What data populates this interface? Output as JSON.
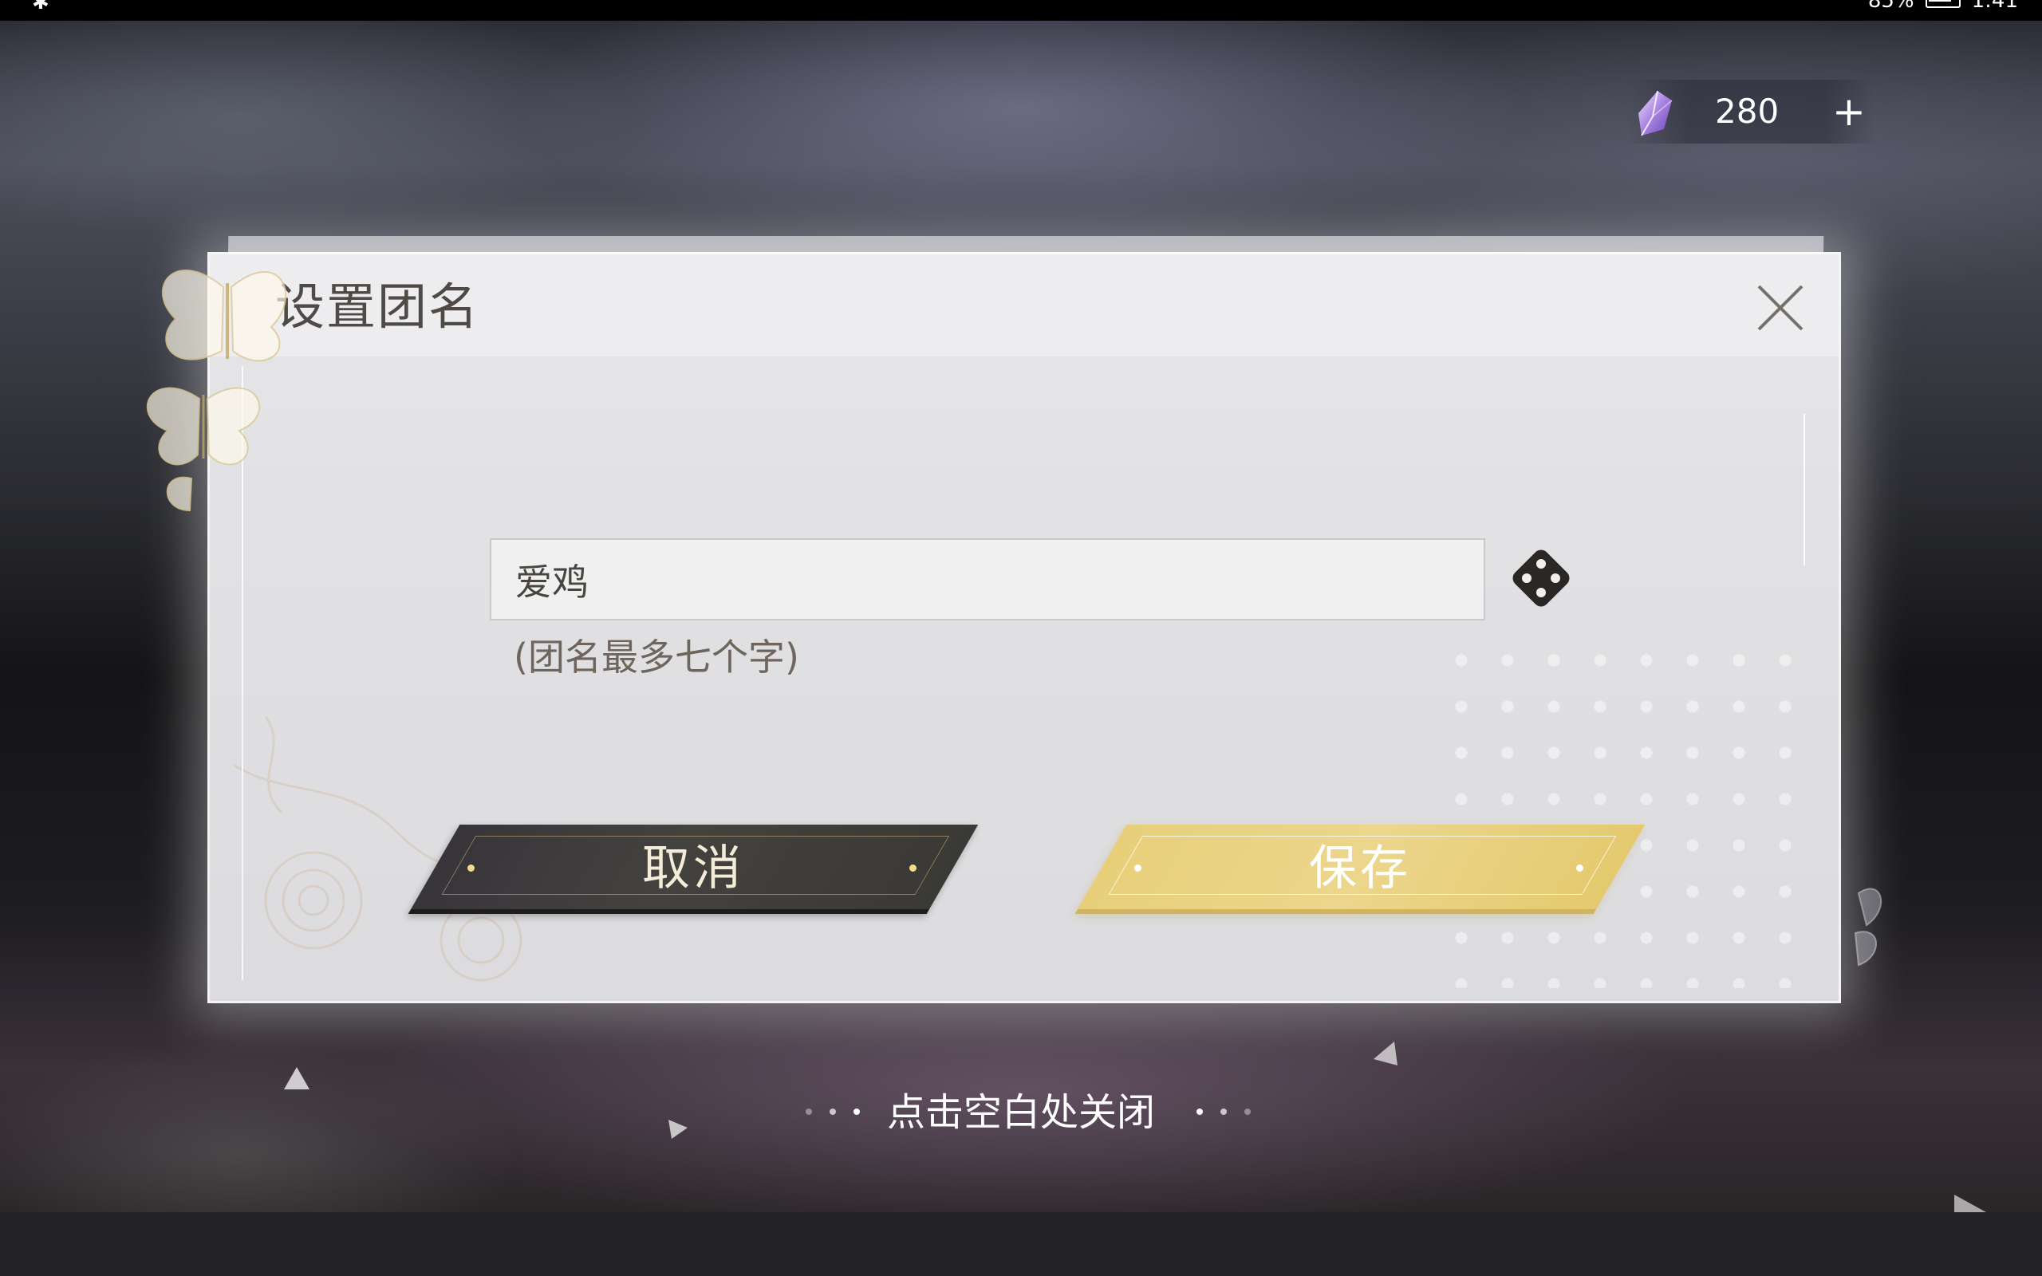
{
  "status_bar": {
    "left_icon": "bluetooth-icon",
    "battery_text": "85%",
    "time": "1:41"
  },
  "currency": {
    "icon": "crystal-gem-icon",
    "amount": "280",
    "add_label": "+"
  },
  "dialog": {
    "title": "设置团名",
    "close_icon": "close-icon",
    "name_input": {
      "value": "爱鸡",
      "placeholder": ""
    },
    "random_icon": "dice-icon",
    "hint": "(团名最多七个字)",
    "cancel_label": "取消",
    "save_label": "保存"
  },
  "footer": {
    "close_hint": "点击空白处关闭"
  },
  "colors": {
    "save_gold": "#e7cf7a",
    "cancel_dark": "#3e3c3a",
    "title_text": "#4f4a46"
  }
}
